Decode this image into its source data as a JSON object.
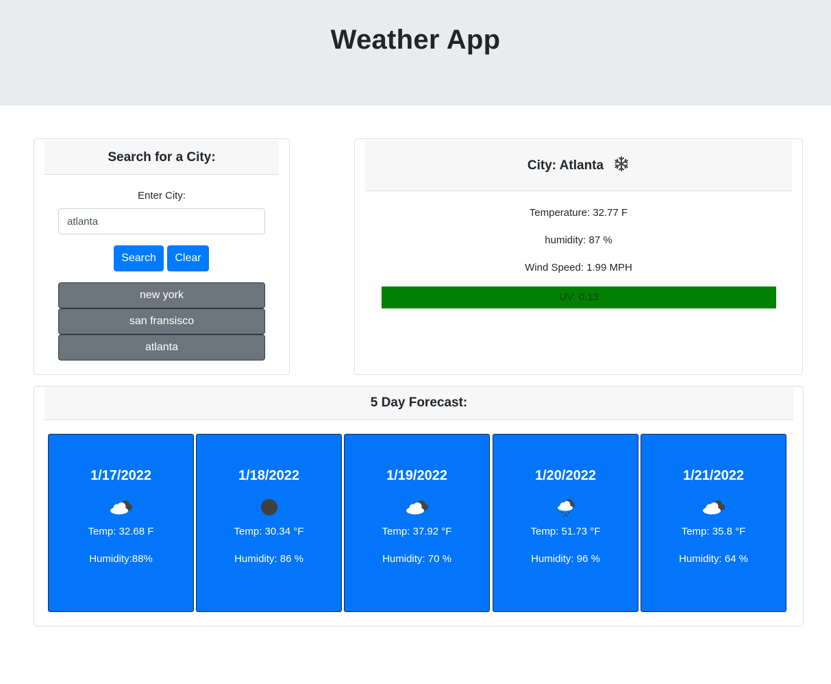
{
  "header": {
    "title": "Weather App"
  },
  "search": {
    "title": "Search for a City:",
    "label": "Enter City:",
    "input_value": "atlanta",
    "search_label": "Search",
    "clear_label": "Clear",
    "history": [
      "new york",
      "san fransisco",
      "atlanta"
    ]
  },
  "current": {
    "city": "City: Atlanta",
    "icon": "snowflake-icon",
    "temperature": "Temperature: 32.77 F",
    "humidity": "humidity: 87 %",
    "wind": "Wind Speed: 1.99 MPH",
    "uv": "UV: 0.13",
    "uv_color": "#008000"
  },
  "forecast": {
    "title": "5 Day Forecast:",
    "days": [
      {
        "date": "1/17/2022",
        "icon": "cloudy-icon",
        "temp": "Temp: 32.68 F",
        "humidity": "Humidity:88%"
      },
      {
        "date": "1/18/2022",
        "icon": "overcast-dot-icon",
        "temp": "Temp: 30.34 °F",
        "humidity": "Humidity: 86 %"
      },
      {
        "date": "1/19/2022",
        "icon": "cloudy-icon",
        "temp": "Temp: 37.92 °F",
        "humidity": "Humidity: 70 %"
      },
      {
        "date": "1/20/2022",
        "icon": "snow-cloud-icon",
        "temp": "Temp: 51.73 °F",
        "humidity": "Humidity: 96 %"
      },
      {
        "date": "1/21/2022",
        "icon": "cloudy-icon",
        "temp": "Temp: 35.8 °F",
        "humidity": "Humidity: 64 %"
      }
    ]
  },
  "colors": {
    "primary": "#007bff",
    "secondary": "#6c757d",
    "forecast_bg": "#0275fa",
    "jumbotron": "#e9ecef"
  }
}
